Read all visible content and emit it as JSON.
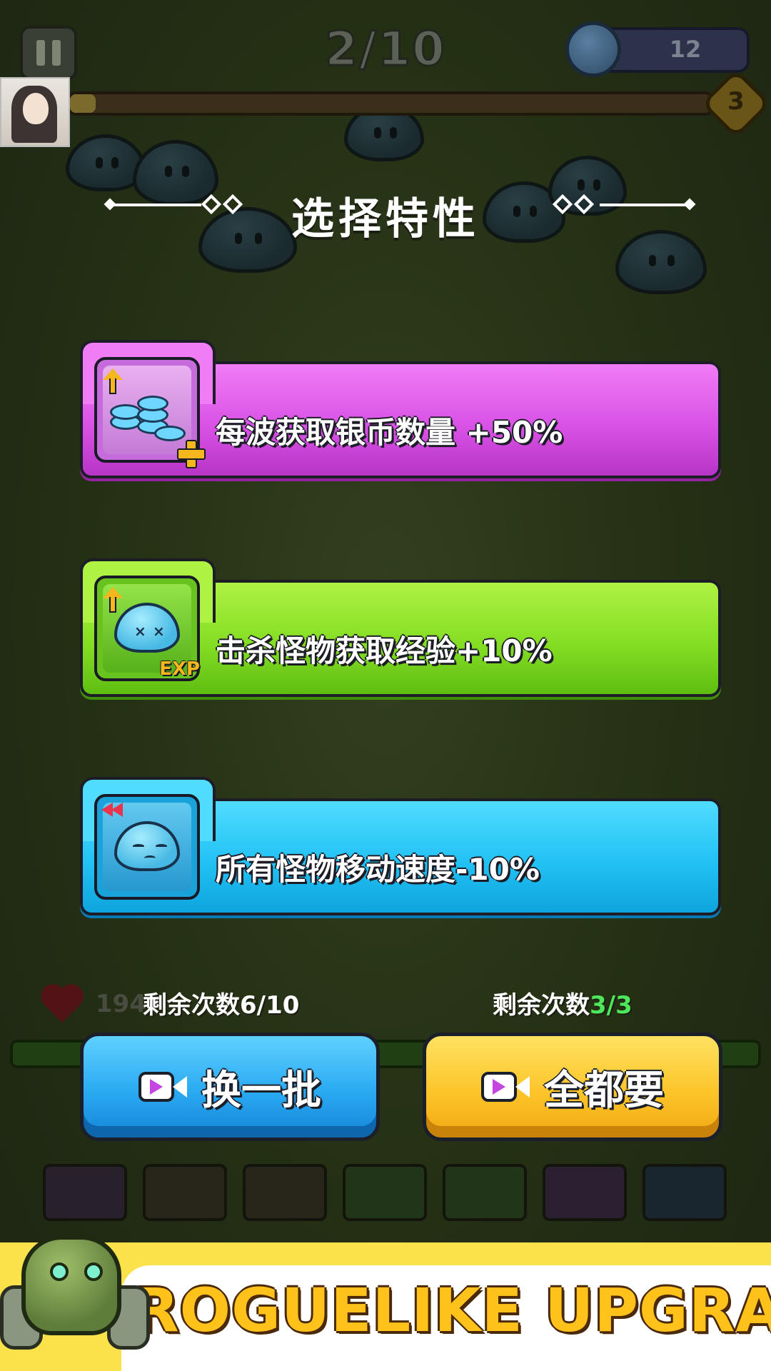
{
  "hud": {
    "wave": "2/10",
    "coins": "12",
    "level": "3"
  },
  "dialog": {
    "title": "选择特性"
  },
  "cards": [
    {
      "label": "每波获取银币数量 +50%",
      "color": "#e15fee",
      "icon": "silver-coins-plus-icon"
    },
    {
      "label": "击杀怪物获取经验+10%",
      "color": "#8fe02a",
      "icon": "slime-exp-icon",
      "icon_tag": "EXP"
    },
    {
      "label": "所有怪物移动速度-10%",
      "color": "#27c3f3",
      "icon": "slow-slime-icon"
    }
  ],
  "actions": {
    "refresh": {
      "remain_label": "剩余次数",
      "remain_value": "6/10",
      "label": "换一批",
      "color": "#2aaaf2"
    },
    "take_all": {
      "remain_label": "剩余次数",
      "remain_value": "3/3",
      "label": "全都要",
      "color": "#fcc52a"
    }
  },
  "background": {
    "hp": "194"
  },
  "banner": {
    "text": "ROGUELIKE UPGRADE"
  }
}
